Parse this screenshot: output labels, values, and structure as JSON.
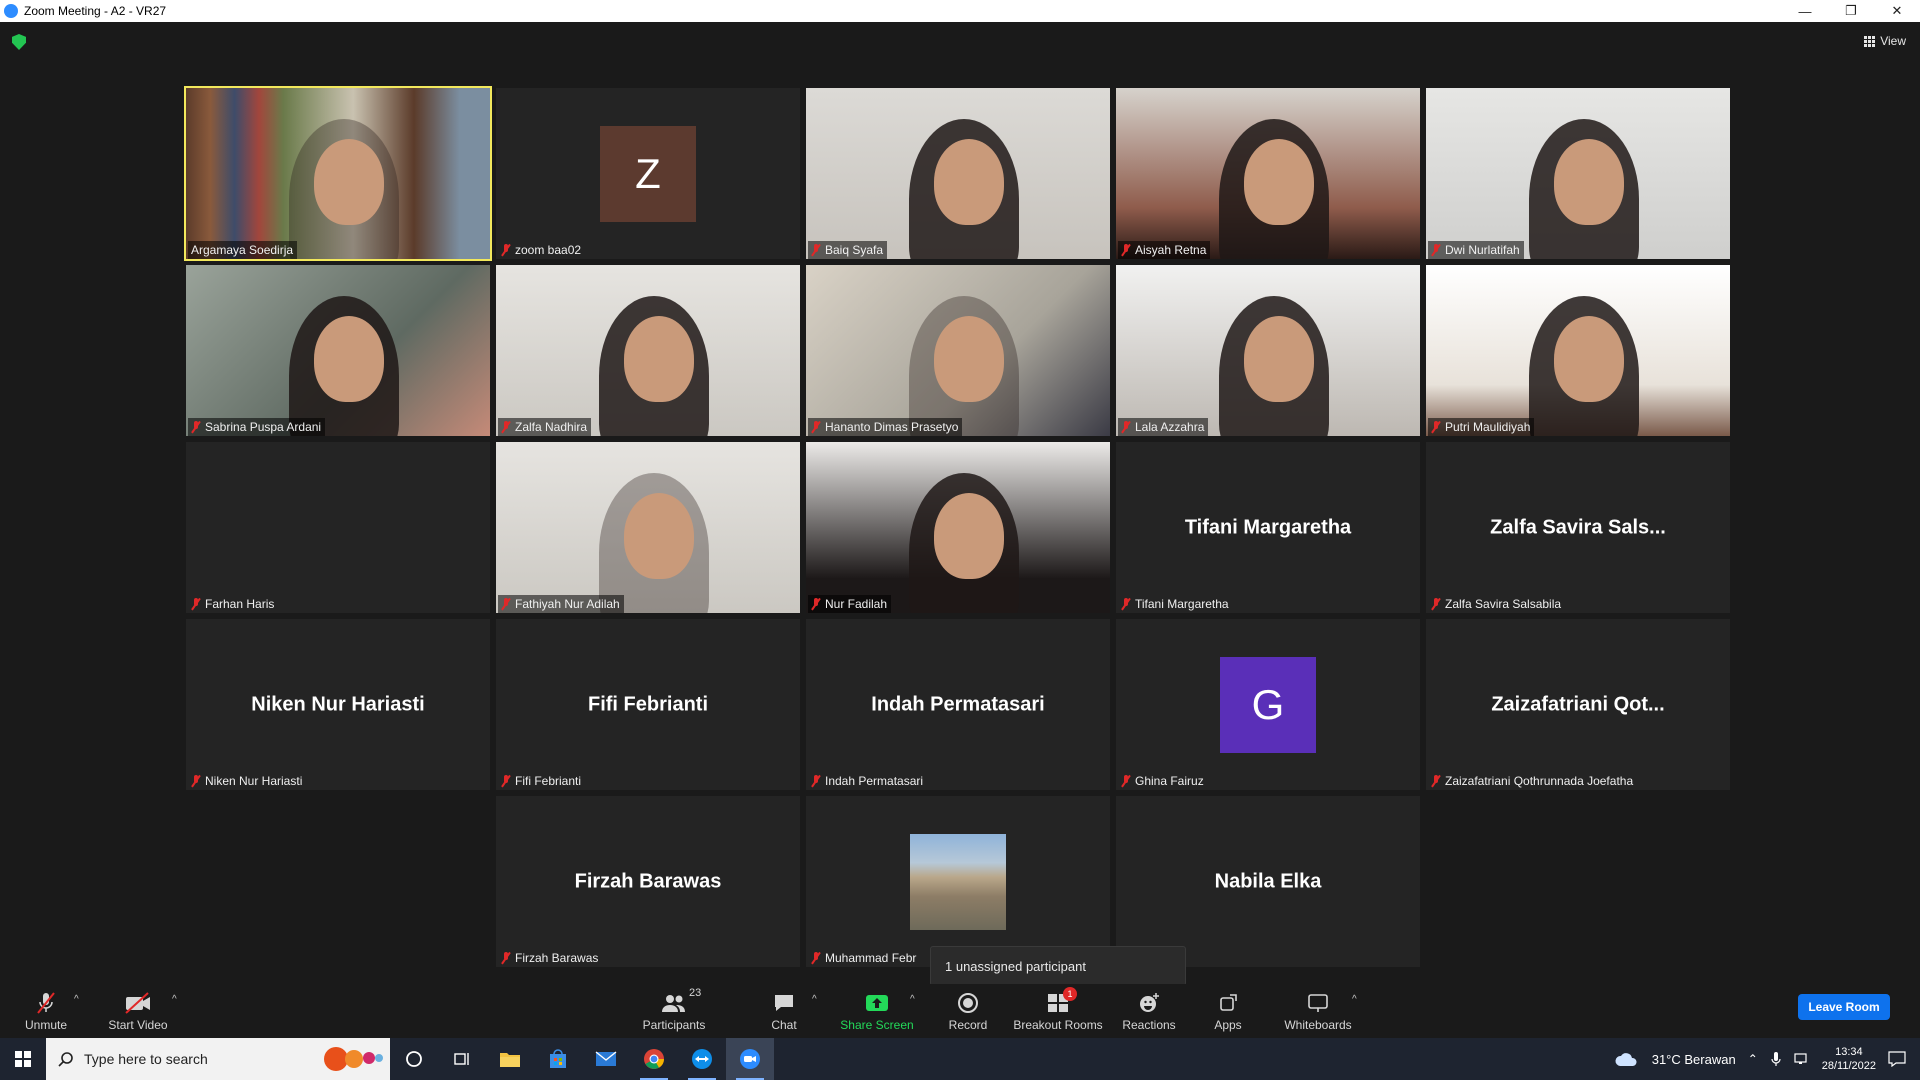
{
  "window": {
    "title": "Zoom Meeting - A2 - VR27",
    "minimize": "—",
    "restore": "❐",
    "close": "✕"
  },
  "header": {
    "view_label": "View"
  },
  "tiles": [
    {
      "name": "Argamaya Soedirja",
      "type": "video",
      "active": true,
      "muted": false
    },
    {
      "name": "zoom baa02",
      "type": "avatar",
      "initial": "Z",
      "avatar_color": "#5c3a2f",
      "muted": true
    },
    {
      "name": "Baiq Syafa",
      "type": "video",
      "muted": true
    },
    {
      "name": "Aisyah Retna",
      "type": "video",
      "muted": true
    },
    {
      "name": "Dwi Nurlatifah",
      "type": "video",
      "muted": true
    },
    {
      "name": "Sabrina Puspa Ardani",
      "type": "video",
      "muted": true
    },
    {
      "name": "Zalfa Nadhira",
      "type": "video",
      "muted": true
    },
    {
      "name": "Hananto Dimas Prasetyo",
      "type": "video",
      "muted": true
    },
    {
      "name": "Lala Azzahra",
      "type": "video",
      "muted": true
    },
    {
      "name": "Putri Maulidiyah",
      "type": "video",
      "muted": true
    },
    {
      "name": "Farhan Haris",
      "type": "blank",
      "muted": true
    },
    {
      "name": "Fathiyah Nur Adilah",
      "type": "video",
      "muted": true
    },
    {
      "name": "Nur Fadilah",
      "type": "video",
      "muted": true
    },
    {
      "name": "Tifani Margaretha",
      "type": "name",
      "display": "Tifani Margaretha",
      "muted": true
    },
    {
      "name": "Zalfa Savira Salsabila",
      "type": "name",
      "display": "Zalfa Savira Sals...",
      "muted": true
    },
    {
      "name": "Niken Nur Hariasti",
      "type": "name",
      "display": "Niken Nur Hariasti",
      "muted": true
    },
    {
      "name": "Fifi Febrianti",
      "type": "name",
      "display": "Fifi Febrianti",
      "muted": true
    },
    {
      "name": "Indah Permatasari",
      "type": "name",
      "display": "Indah Permatasari",
      "muted": true
    },
    {
      "name": "Ghina Fairuz",
      "type": "avatar",
      "initial": "G",
      "avatar_color": "#5a2fb8",
      "muted": true
    },
    {
      "name": "Zaizafatriani Qothrunnada Joefatha",
      "type": "name",
      "display": "Zaizafatriani  Qot...",
      "muted": true
    },
    {
      "name": "Firzah Barawas",
      "type": "name",
      "display": "Firzah Barawas",
      "muted": true
    },
    {
      "name": "Muhammad Febr",
      "type": "photo",
      "muted": true
    },
    {
      "name": "",
      "type": "name",
      "display": "Nabila Elka",
      "muted": true
    }
  ],
  "tooltip": {
    "text": "1 unassigned participant"
  },
  "toolbar": {
    "unmute": "Unmute",
    "start_video": "Start Video",
    "participants": "Participants",
    "participants_count": "23",
    "chat": "Chat",
    "share_screen": "Share Screen",
    "record": "Record",
    "breakout_rooms": "Breakout Rooms",
    "breakout_badge": "1",
    "reactions": "Reactions",
    "apps": "Apps",
    "whiteboards": "Whiteboards",
    "leave_room": "Leave Room",
    "colors": {
      "share": "#23d959",
      "leave": "#0e72ed",
      "muted": "#e02828"
    }
  },
  "taskbar": {
    "search_placeholder": "Type here to search",
    "weather": "31°C  Berawan",
    "time": "13:34",
    "date": "28/11/2022"
  }
}
